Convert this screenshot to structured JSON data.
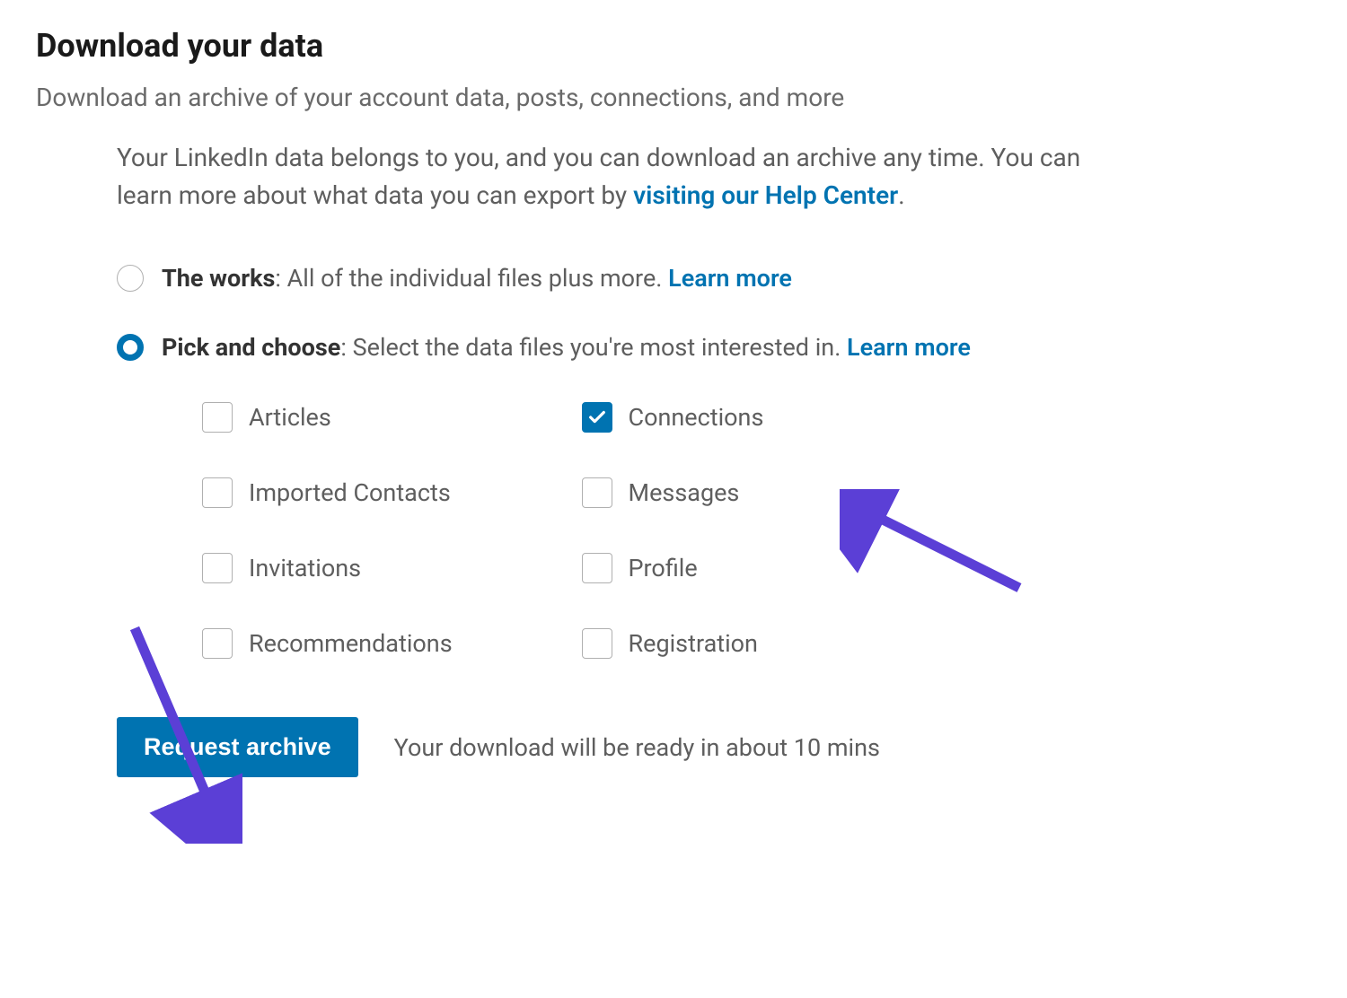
{
  "header": {
    "title": "Download your data",
    "subtitle": "Download an archive of your account data, posts, connections, and more"
  },
  "info": {
    "text_prefix": "Your LinkedIn data belongs to you, and you can download an archive any time. You can learn more about what data you can export by ",
    "link_text": "visiting our Help Center",
    "text_suffix": "."
  },
  "options": {
    "works": {
      "bold": "The works",
      "desc": ": All of the individual files plus more. ",
      "link": "Learn more",
      "selected": false
    },
    "pick": {
      "bold": "Pick and choose",
      "desc": ": Select the data files you're most interested in. ",
      "link": "Learn more",
      "selected": true
    }
  },
  "checkboxes": [
    {
      "label": "Articles",
      "checked": false
    },
    {
      "label": "Connections",
      "checked": true
    },
    {
      "label": "Imported Contacts",
      "checked": false
    },
    {
      "label": "Messages",
      "checked": false
    },
    {
      "label": "Invitations",
      "checked": false
    },
    {
      "label": "Profile",
      "checked": false
    },
    {
      "label": "Recommendations",
      "checked": false
    },
    {
      "label": "Registration",
      "checked": false
    }
  ],
  "action": {
    "button": "Request archive",
    "status": "Your download will be ready in about 10 mins"
  },
  "annotation": {
    "arrow_color": "#5b3fd6"
  }
}
